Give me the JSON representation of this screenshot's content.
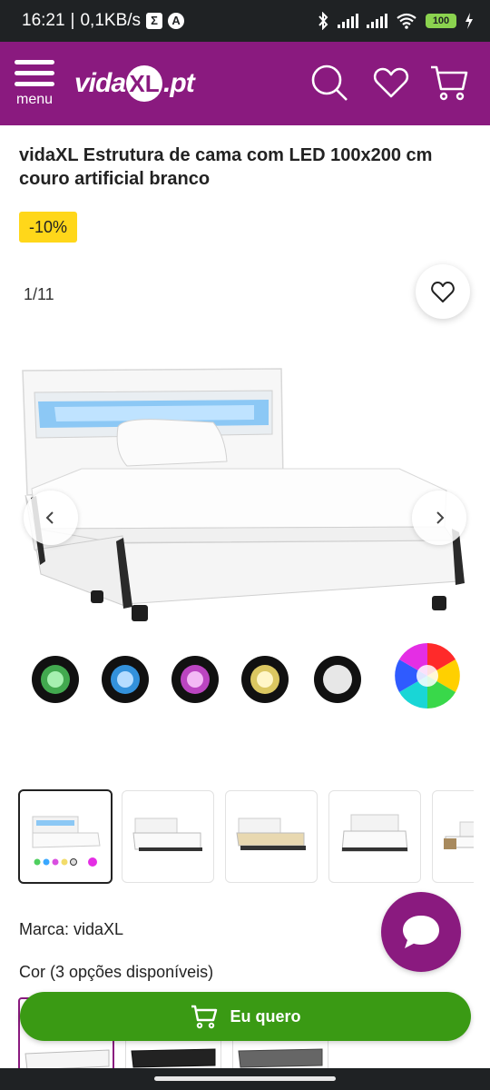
{
  "status_bar": {
    "time": "16:21",
    "speed": "0,1KB/s",
    "battery": "100",
    "icons": [
      "sigma-icon",
      "a-icon",
      "bluetooth-icon",
      "signal-icon",
      "signal-icon",
      "wifi-icon",
      "battery-icon",
      "charging-icon"
    ]
  },
  "header": {
    "menu_label": "menu",
    "logo_prefix": "vida",
    "logo_xl": "XL",
    "logo_suffix": ".pt",
    "brand_color": "#8a1a7f"
  },
  "product": {
    "title": "vidaXL Estrutura de cama com LED 100x200 cm couro artificial branco",
    "discount": "-10%",
    "counter": "1/11",
    "brand": "Marca: vidaXL",
    "color_label": "Cor (3 opções disponíveis)",
    "led_colors": [
      "#4fcf5f",
      "#3aa8ff",
      "#d94fe0",
      "#f2dc6a",
      "#ffffff"
    ]
  },
  "thumbnails": [
    "bed-led-colors",
    "bed-side",
    "bed-frame",
    "bed-front",
    "bed-partial"
  ],
  "variants": [
    "white",
    "black",
    "grey"
  ],
  "cta": {
    "label": "Eu quero",
    "color": "#3a9a14"
  }
}
